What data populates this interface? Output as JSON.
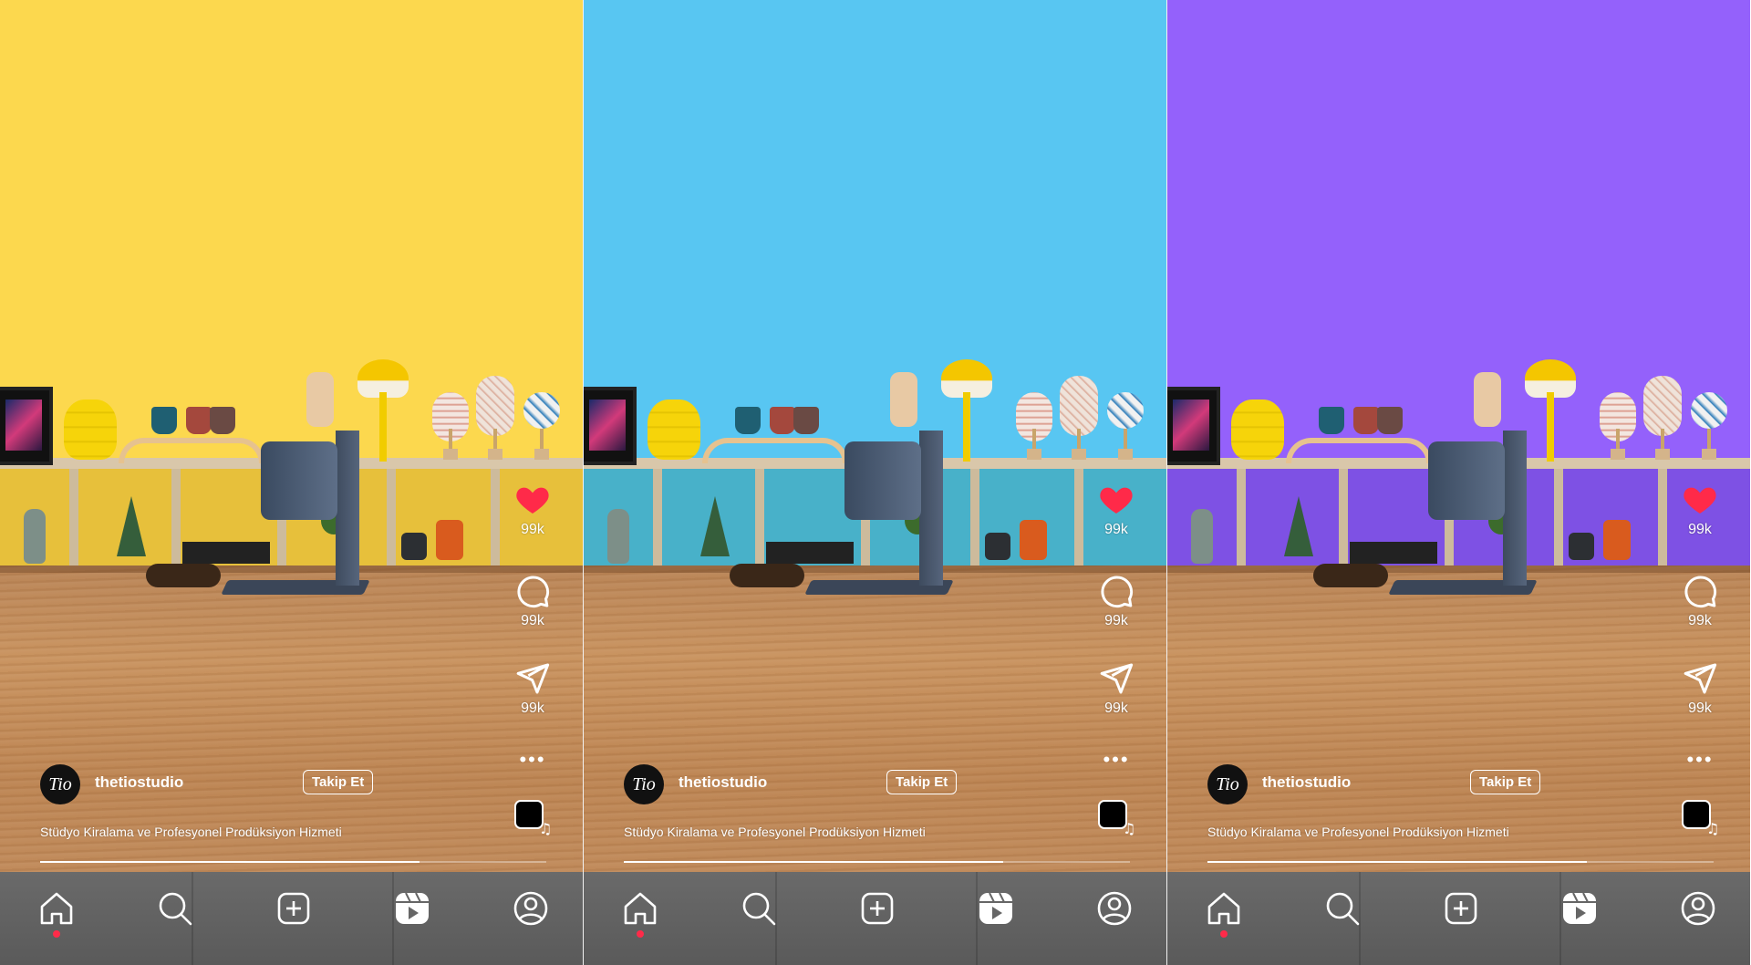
{
  "panels": [
    {
      "wall_color": "#fcd84e",
      "shelf_color": "#e7c03b",
      "post": {
        "username": "thetiostudio",
        "avatar_text": "Tio",
        "follow_label": "Takip Et",
        "caption": "Stüdyo Kiralama ve Profesyonel Prodüksiyon Hizmeti"
      },
      "actions": {
        "likes": "99k",
        "comments": "99k",
        "shares": "99k",
        "more": "•••"
      },
      "progress": 0.75
    },
    {
      "wall_color": "#58c6f2",
      "shelf_color": "#48b1c9",
      "post": {
        "username": "thetiostudio",
        "avatar_text": "Tio",
        "follow_label": "Takip Et",
        "caption": "Stüdyo Kiralama ve Profesyonel Prodüksiyon Hizmeti"
      },
      "actions": {
        "likes": "99k",
        "comments": "99k",
        "shares": "99k",
        "more": "•••"
      },
      "progress": 0.75
    },
    {
      "wall_color": "#9461fb",
      "shelf_color": "#7e51e4",
      "post": {
        "username": "thetiostudio",
        "avatar_text": "Tio",
        "follow_label": "Takip Et",
        "caption": "Stüdyo Kiralama ve Profesyonel Prodüksiyon Hizmeti"
      },
      "actions": {
        "likes": "99k",
        "comments": "99k",
        "shares": "99k",
        "more": "•••"
      },
      "progress": 0.75
    }
  ],
  "nav": {
    "items": [
      "home-icon",
      "search-icon",
      "create-icon",
      "reels-icon",
      "profile-icon"
    ],
    "active": "home-icon"
  },
  "colors": {
    "like": "#ff2a49",
    "nav_dot": "#ff2a49"
  }
}
